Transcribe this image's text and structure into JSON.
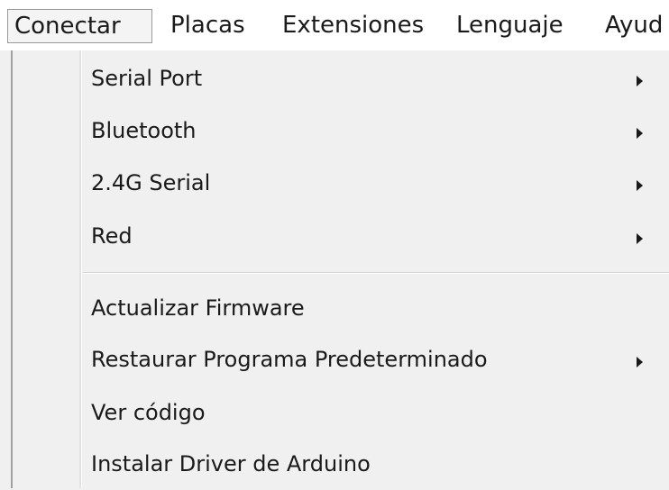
{
  "menubar": {
    "items": [
      "Conectar",
      "Placas",
      "Extensiones",
      "Lenguaje",
      "Ayud"
    ]
  },
  "menu": {
    "group1": [
      {
        "label": "Serial Port",
        "submenu": true
      },
      {
        "label": "Bluetooth",
        "submenu": true
      },
      {
        "label": "2.4G Serial",
        "submenu": true
      },
      {
        "label": "Red",
        "submenu": true
      }
    ],
    "group2": [
      {
        "label": "Actualizar Firmware",
        "submenu": false
      },
      {
        "label": "Restaurar Programa Predeterminado",
        "submenu": true
      },
      {
        "label": "Ver código",
        "submenu": false
      },
      {
        "label": "Instalar Driver de Arduino",
        "submenu": false
      }
    ]
  },
  "icons": {
    "submenu_arrow": "triangle-right-icon"
  }
}
